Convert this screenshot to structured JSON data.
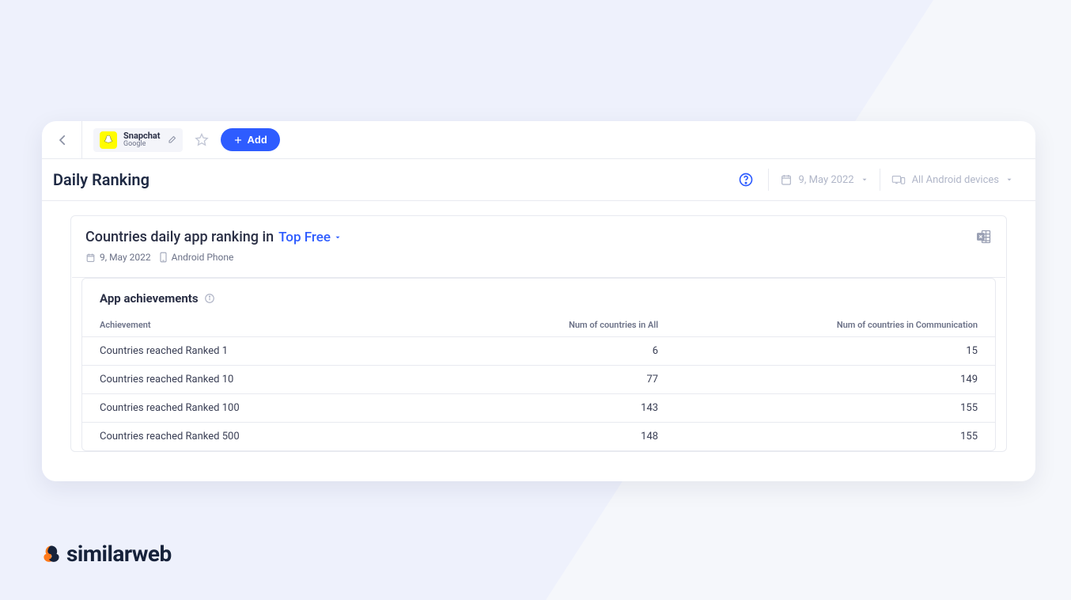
{
  "app": {
    "name": "Snapchat",
    "publisher": "Google"
  },
  "toolbar": {
    "add_label": "Add"
  },
  "page": {
    "title": "Daily Ranking"
  },
  "filters": {
    "date": "9, May 2022",
    "device": "All Android devices"
  },
  "panel": {
    "title_prefix": "Countries daily app ranking in",
    "category": "Top Free",
    "meta_date": "9, May 2022",
    "meta_device": "Android Phone"
  },
  "achievements": {
    "title": "App achievements",
    "columns": [
      "Achievement",
      "Num of countries in All",
      "Num of countries in Communication"
    ],
    "rows": [
      {
        "label": "Countries reached Ranked 1",
        "all": 6,
        "comm": 15
      },
      {
        "label": "Countries reached Ranked 10",
        "all": 77,
        "comm": 149
      },
      {
        "label": "Countries reached Ranked 100",
        "all": 143,
        "comm": 155
      },
      {
        "label": "Countries reached Ranked 500",
        "all": 148,
        "comm": 155
      }
    ]
  },
  "brand": "similarweb"
}
